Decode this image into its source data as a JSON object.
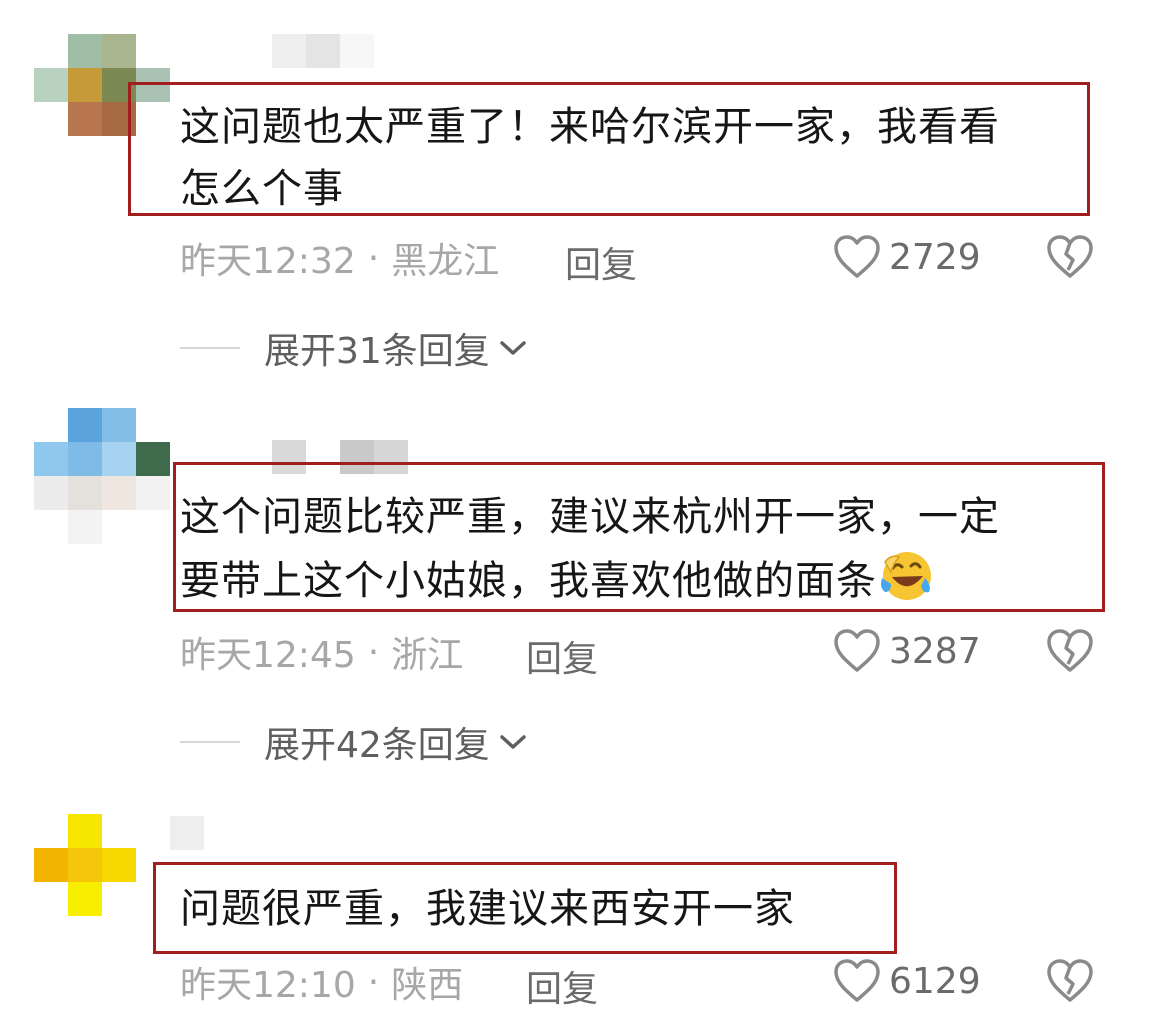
{
  "comments": [
    {
      "text_line1": "这问题也太严重了！来哈尔滨开一家，我看看",
      "text_line2": "怎么个事",
      "time": "昨天12:32",
      "location": "黑龙江",
      "reply": "回复",
      "likes": "2729",
      "expand": "展开31条回复"
    },
    {
      "text_line1": "这个问题比较严重，建议来杭州开一家，一定",
      "text_line2": "要带上这个小姑娘，我喜欢他做的面条",
      "time": "昨天12:45",
      "location": "浙江",
      "reply": "回复",
      "likes": "3287",
      "expand": "展开42条回复"
    },
    {
      "text_line1": "问题很严重，我建议来西安开一家",
      "time": "昨天12:10",
      "location": "陕西",
      "reply": "回复",
      "likes": "6129"
    }
  ],
  "meta_separator": "·",
  "colors": {
    "highlight_border": "#a21d1d",
    "meta_text": "#a7a7a7",
    "body_text": "#161616"
  },
  "icons": {
    "like": "heart-outline-icon",
    "dislike": "broken-heart-icon",
    "expand": "chevron-down-icon",
    "emoji": "laughing-tears-emoji"
  }
}
